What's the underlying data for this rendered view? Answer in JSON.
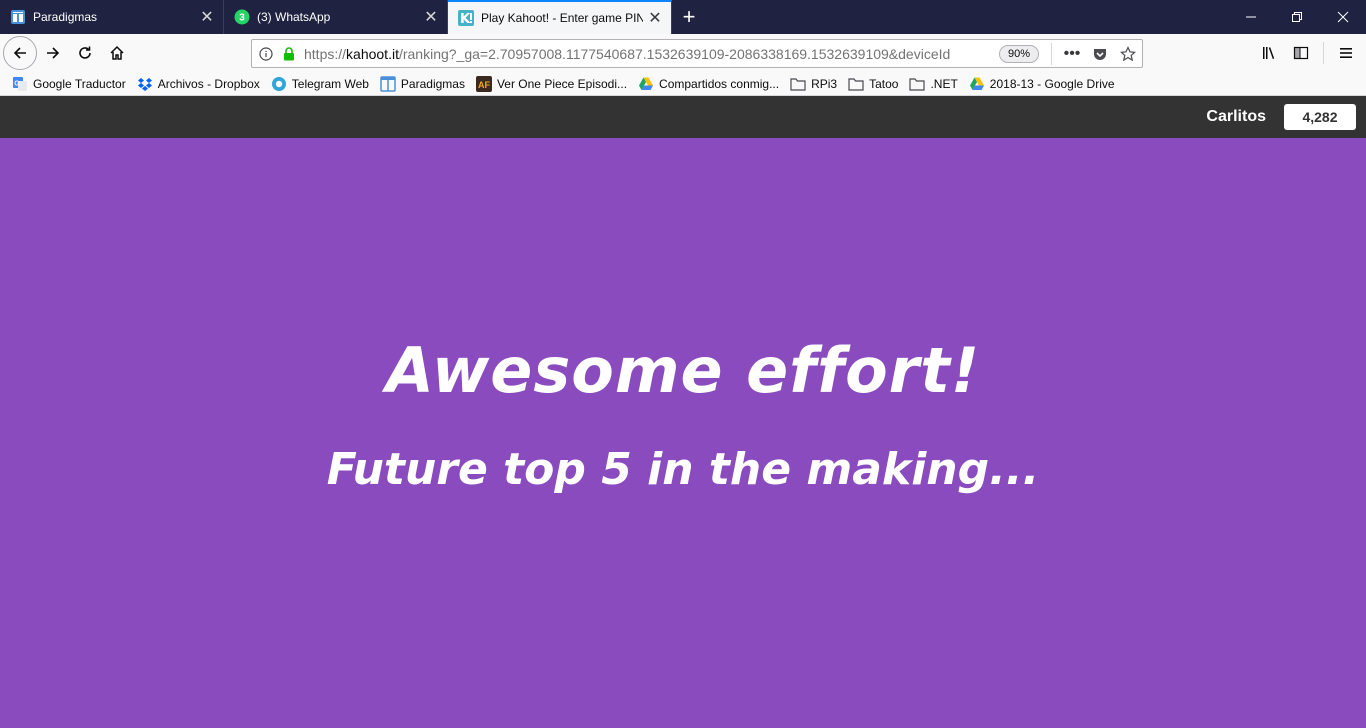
{
  "tabs": [
    {
      "title": "Paradigmas",
      "icon": "table-layout-icon",
      "active": false
    },
    {
      "title": "(3) WhatsApp",
      "icon": "whatsapp-icon",
      "badge": "3",
      "active": false
    },
    {
      "title": "Play Kahoot! - Enter game PIN | ",
      "icon": "kahoot-icon",
      "active": true
    }
  ],
  "url": {
    "prefix": "https://",
    "host": "kahoot.it",
    "path": "/ranking?_ga=2.70957008.1177540687.1532639109-2086338169.1532639109&deviceId",
    "zoom": "90%"
  },
  "bookmarks": [
    {
      "label": "Google Traductor",
      "icon": "google-translate-icon"
    },
    {
      "label": "Archivos - Dropbox",
      "icon": "dropbox-icon"
    },
    {
      "label": "Telegram Web",
      "icon": "telegram-icon"
    },
    {
      "label": "Paradigmas",
      "icon": "table-layout-icon"
    },
    {
      "label": "Ver One Piece Episodi...",
      "icon": "af-logo-icon"
    },
    {
      "label": "Compartidos conmig...",
      "icon": "google-drive-icon"
    },
    {
      "label": "RPi3",
      "icon": "folder-icon"
    },
    {
      "label": "Tatoo",
      "icon": "folder-icon"
    },
    {
      "label": ".NET",
      "icon": "folder-icon"
    },
    {
      "label": "2018-13 - Google Drive",
      "icon": "google-drive-icon"
    }
  ],
  "kahoot": {
    "player_name": "Carlitos",
    "score": "4,282",
    "headline": "Awesome effort!",
    "subline": "Future top 5 in the making..."
  },
  "colors": {
    "background": "#8a4bbf",
    "topbar": "#333333",
    "tabstrip": "#1f2240",
    "accent": "#0a84ff"
  }
}
